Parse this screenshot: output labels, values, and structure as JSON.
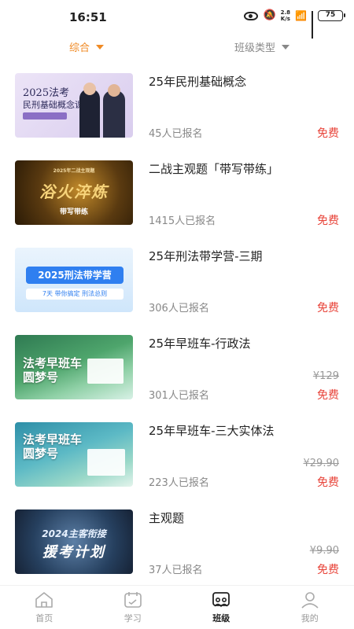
{
  "status_bar": {
    "time": "16:51",
    "net_speed_top": "2.8",
    "net_speed_bottom": "K/s",
    "battery": "75"
  },
  "filters": {
    "all_label": "综合",
    "type_label": "班级类型"
  },
  "courses": [
    {
      "title": "25年民刑基础概念",
      "enrolled": "45人已报名",
      "price": "免费",
      "original_price": "",
      "thumb": {
        "line1": "2025法考",
        "line2": "民刑基础概念课"
      }
    },
    {
      "title": "二战主观题「带写带练」",
      "enrolled": "1415人已报名",
      "price": "免费",
      "original_price": "",
      "thumb": {
        "small": "2025年二战主观题",
        "big": "浴火淬炼",
        "tag": "带写带练"
      }
    },
    {
      "title": "25年刑法带学营-三期",
      "enrolled": "306人已报名",
      "price": "免费",
      "original_price": "",
      "thumb": {
        "banner": "2025刑法带学营",
        "sub": "7天 带你搞定 刑法总则"
      }
    },
    {
      "title": "25年早班车-行政法",
      "enrolled": "301人已报名",
      "price": "免费",
      "original_price": "¥129",
      "thumb": {
        "line1": "法考早班车",
        "line2": "圆梦号"
      }
    },
    {
      "title": "25年早班车-三大实体法",
      "enrolled": "223人已报名",
      "price": "免费",
      "original_price": "¥29.90",
      "thumb": {
        "line1": "法考早班车",
        "line2": "圆梦号"
      }
    },
    {
      "title": "主观题",
      "enrolled": "37人已报名",
      "price": "免费",
      "original_price": "¥9.90",
      "thumb": {
        "line1": "2024主客衔接",
        "line2": "援考计划"
      }
    }
  ],
  "tab_bar": {
    "items": [
      {
        "label": "首页",
        "icon": "home-icon"
      },
      {
        "label": "学习",
        "icon": "calendar-icon"
      },
      {
        "label": "班级",
        "icon": "class-icon"
      },
      {
        "label": "我的",
        "icon": "profile-icon"
      }
    ],
    "active_index": 2
  },
  "colors": {
    "accent": "#f08a24",
    "price": "#e8443a",
    "muted": "#888888"
  }
}
